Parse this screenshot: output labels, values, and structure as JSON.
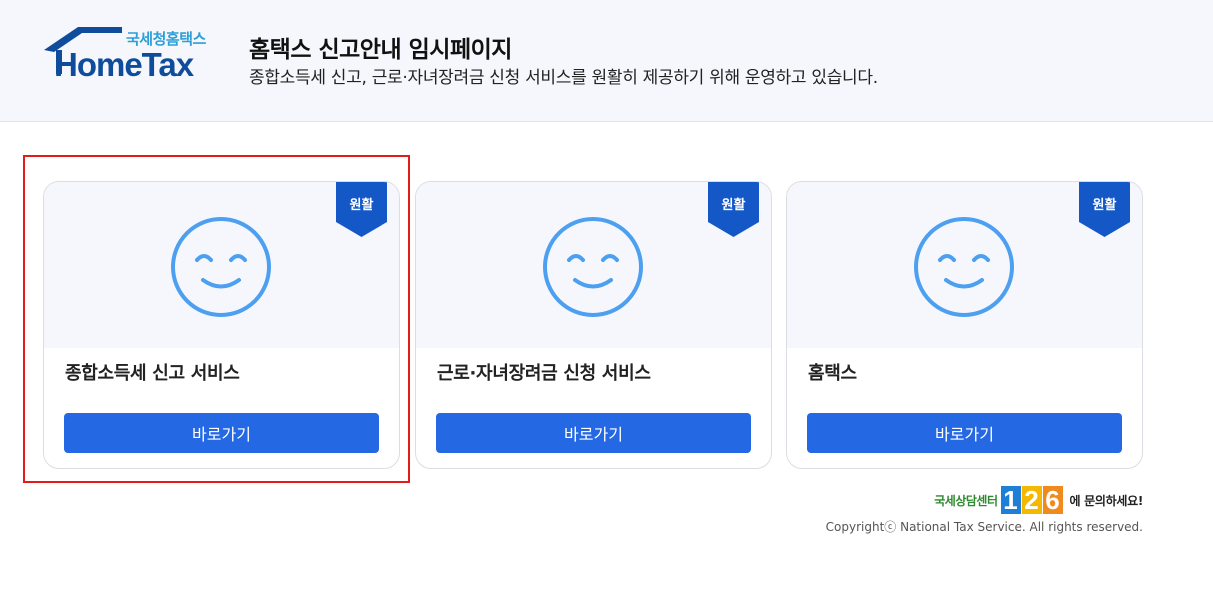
{
  "header": {
    "logo_sub": "국세청홈택스",
    "logo_main": "HomeTax",
    "title": "홈택스 신고안내 임시페이지",
    "subtitle": "종합소득세 신고, 근로·자녀장려금 신청 서비스를 원활히 제공하기 위해 운영하고 있습니다."
  },
  "cards": [
    {
      "title": "종합소득세 신고 서비스",
      "badge": "원활",
      "button": "바로가기",
      "icon": "smiley-icon"
    },
    {
      "title": "근로·자녀장려금 신청 서비스",
      "badge": "원활",
      "button": "바로가기",
      "icon": "smiley-icon"
    },
    {
      "title": "홈택스",
      "badge": "원활",
      "button": "바로가기",
      "icon": "smiley-icon"
    }
  ],
  "footer": {
    "contact_prefix": "국세상담센터",
    "contact_digits": [
      "1",
      "2",
      "6"
    ],
    "contact_suffix": "에 문의하세요!",
    "copyright": "Copyrightⓒ National Tax Service. All rights reserved."
  },
  "colors": {
    "accent_blue": "#2469e3",
    "badge_blue": "#1458c8",
    "smiley_blue": "#4d9ff0",
    "highlight_red": "#e31b1b",
    "digit_blue": "#1e7fd6",
    "digit_yellow": "#f5b800",
    "digit_orange": "#f08a1c"
  }
}
